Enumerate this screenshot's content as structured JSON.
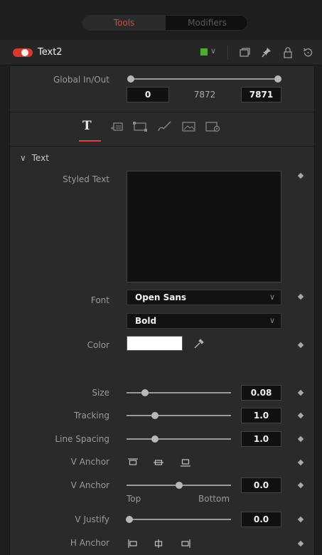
{
  "tabs": {
    "tools": "Tools",
    "modifiers": "Modifiers"
  },
  "node": {
    "name": "Text2",
    "color": "#4cae2c"
  },
  "global_in_out": {
    "label": "Global In/Out",
    "start": "0",
    "mid": "7872",
    "end": "7871"
  },
  "section": {
    "title": "Text"
  },
  "fields": {
    "styled_text": "Styled Text",
    "font": "Font",
    "font_value": "Open Sans",
    "style_value": "Bold",
    "color": "Color",
    "size": "Size",
    "size_value": "0.08",
    "tracking": "Tracking",
    "tracking_value": "1.0",
    "line_spacing": "Line Spacing",
    "line_spacing_value": "1.0",
    "v_anchor": "V Anchor",
    "v_anchor2": "V Anchor",
    "v_anchor2_value": "0.0",
    "top": "Top",
    "bottom": "Bottom",
    "v_justify": "V Justify",
    "v_justify_value": "0.0",
    "h_anchor": "H Anchor"
  },
  "colors": {
    "accent": "#e0433a",
    "toggle": "#d8382f"
  }
}
